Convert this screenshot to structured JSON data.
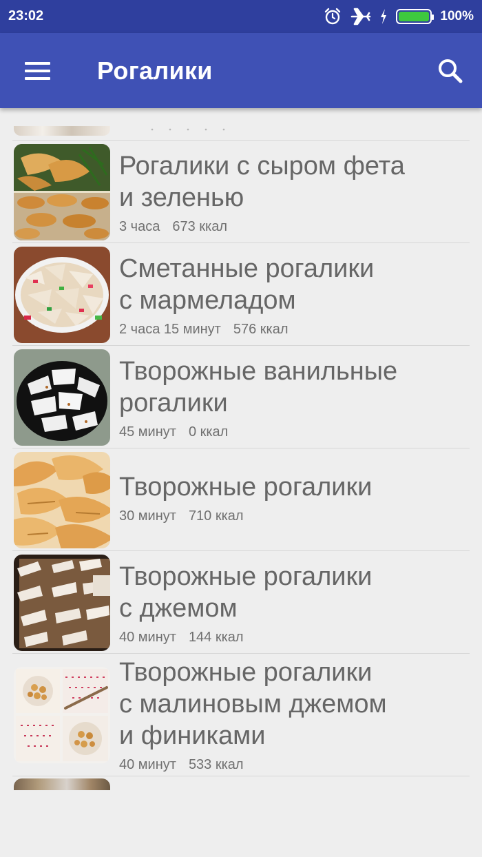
{
  "status_bar": {
    "time": "23:02",
    "battery_percent": "100%",
    "battery_level": 1.0,
    "icons": [
      "alarm-icon",
      "airplane-icon",
      "charging-icon",
      "battery-icon"
    ]
  },
  "app_bar": {
    "title": "Рогалики",
    "menu_icon": "hamburger-menu-icon",
    "search_icon": "search-icon"
  },
  "colors": {
    "status_bar": "#2f3f9e",
    "app_bar": "#3f51b5",
    "background": "#eeeeee",
    "title_text": "#666666",
    "battery_fill": "#3ec93e"
  },
  "recipes": [
    {
      "title_lines": [
        "Рогалики с сыром фета",
        "и зеленью"
      ],
      "time": "3 часа",
      "calories": "673 ккал"
    },
    {
      "title_lines": [
        "Сметанные рогалики",
        "с мармеладом"
      ],
      "time": "2 часа 15 минут",
      "calories": "576 ккал"
    },
    {
      "title_lines": [
        "Творожные ванильные",
        "рогалики"
      ],
      "time": "45 минут",
      "calories": "0 ккал"
    },
    {
      "title_lines": [
        "Творожные рогалики"
      ],
      "time": "30 минут",
      "calories": "710 ккал"
    },
    {
      "title_lines": [
        "Творожные рогалики",
        "с джемом"
      ],
      "time": "40 минут",
      "calories": "144 ккал"
    },
    {
      "title_lines": [
        "Творожные рогалики",
        "с малиновым джемом",
        "и финиками"
      ],
      "time": "40 минут",
      "calories": "533 ккал"
    }
  ]
}
